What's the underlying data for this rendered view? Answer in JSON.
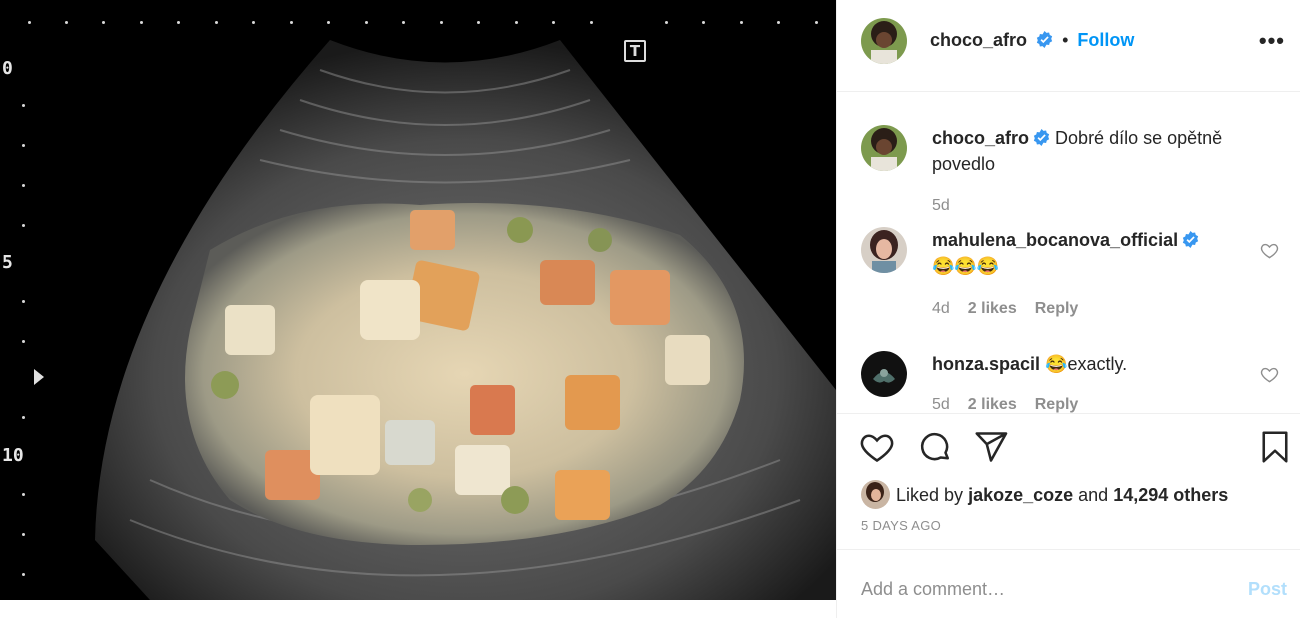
{
  "post": {
    "image_scale_labels": [
      "0",
      "5",
      "10"
    ],
    "image_t_mark": "T"
  },
  "header": {
    "username": "choco_afro",
    "separator": "•",
    "follow_label": "Follow",
    "more_label": "•••"
  },
  "caption": {
    "username": "choco_afro",
    "text": "Dobré dílo se opětně povedlo",
    "age": "5d"
  },
  "comments": [
    {
      "username": "mahulena_bocanova_official",
      "text": "😂😂😂",
      "age": "4d",
      "likes": "2 likes",
      "reply": "Reply"
    },
    {
      "username": "honza.spacil",
      "text": "😂exactly.",
      "age": "5d",
      "likes": "2 likes",
      "reply": "Reply"
    }
  ],
  "likes": {
    "prefix": "Liked by",
    "user": "jakoze_coze",
    "middle": "and",
    "others": "14,294 others"
  },
  "timestamp": "5 DAYS AGO",
  "add_comment": {
    "placeholder": "Add a comment…",
    "post_label": "Post"
  },
  "colors": {
    "link_blue": "#0095f6",
    "verified_blue": "#3897f0",
    "post_disabled": "#b2dffc",
    "muted": "#8e8e8e"
  }
}
